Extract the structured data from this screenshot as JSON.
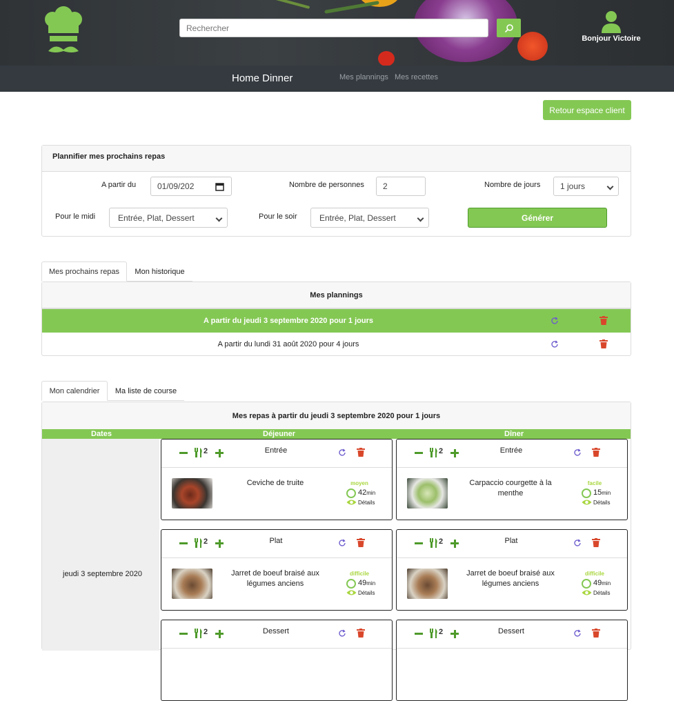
{
  "header": {
    "search_placeholder": "Rechercher",
    "user_greeting": "Bonjour Victoire"
  },
  "navbar": {
    "brand": "Home Dinner",
    "links": [
      "Mes plannings",
      "Mes recettes"
    ]
  },
  "actions": {
    "retour": "Retour espace client"
  },
  "planner": {
    "title": "Plannifier mes prochains repas",
    "start_label": "A partir du",
    "start_value": "01/09/202",
    "persons_label": "Nombre de personnes",
    "persons_value": "2",
    "days_label": "Nombre de jours",
    "days_value": "1 jours",
    "midi_label": "Pour le midi",
    "midi_value": "Entrée, Plat, Dessert",
    "soir_label": "Pour le soir",
    "soir_value": "Entrée, Plat, Dessert",
    "generate": "Générer"
  },
  "plan_tabs": [
    "Mes prochains repas",
    "Mon historique"
  ],
  "plannings": {
    "title": "Mes plannings",
    "rows": [
      "A partir du jeudi 3 septembre 2020 pour 1 jours",
      "A partir du lundi 31 août 2020 pour 4 jours"
    ]
  },
  "cal_tabs": [
    "Mon calendrier",
    "Ma liste de course"
  ],
  "calendar": {
    "title": "Mes repas à partir du jeudi 3 septembre 2020 pour 1 jours",
    "col_dates": "Dates",
    "col_lunch": "Déjeuner",
    "col_dinner": "Dîner",
    "date": "jeudi 3 septembre 2020",
    "details": "Détails",
    "unit": "min",
    "lunch": [
      {
        "course": "Entrée",
        "persons": "2",
        "dish": "Ceviche de truite",
        "difficulty": "moyen",
        "time": "42"
      },
      {
        "course": "Plat",
        "persons": "2",
        "dish": "Jarret de boeuf braisé aux légumes anciens",
        "difficulty": "difficile",
        "time": "49"
      },
      {
        "course": "Dessert",
        "persons": "2"
      }
    ],
    "dinner": [
      {
        "course": "Entrée",
        "persons": "2",
        "dish": "Carpaccio courgette à la menthe",
        "difficulty": "facile",
        "time": "15"
      },
      {
        "course": "Plat",
        "persons": "2",
        "dish": "Jarret de boeuf braisé aux légumes anciens",
        "difficulty": "difficile",
        "time": "49"
      },
      {
        "course": "Dessert",
        "persons": "2"
      }
    ]
  },
  "colors": {
    "accent": "#84c854",
    "nav": "#343a40",
    "danger": "#d9472b",
    "refresh": "#6a5acd"
  }
}
